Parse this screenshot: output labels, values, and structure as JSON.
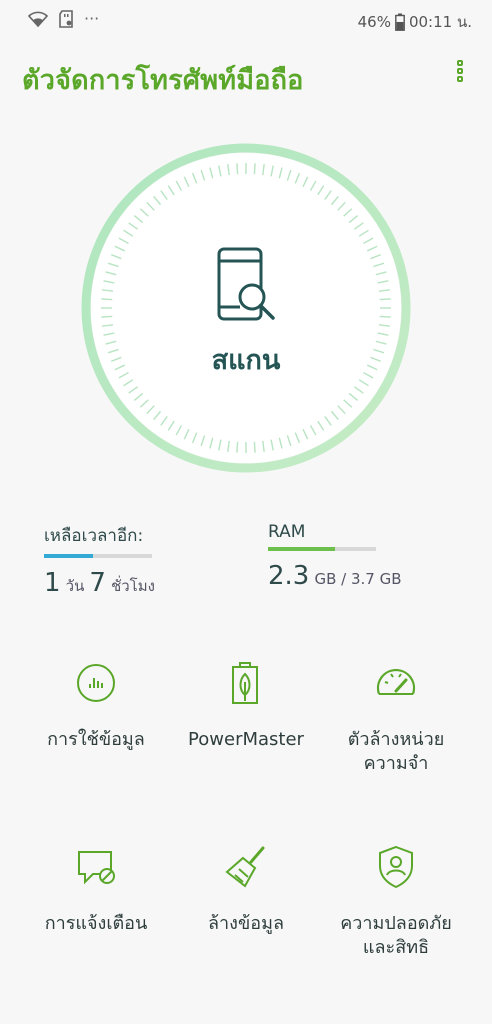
{
  "status_bar": {
    "icons": [
      "wifi-icon",
      "sd-card-icon",
      "more-notifications-icon"
    ],
    "more": "···",
    "battery_percent": "46%",
    "time": "00:11 น."
  },
  "app": {
    "title": "ตัวจัดการโทรศัพท์มือถือ",
    "accent_color": "#5aa72a"
  },
  "scan": {
    "label": "สแกน",
    "icon": "phone-search-icon"
  },
  "battery_stat": {
    "label": "เหลือเวลาอีก:",
    "days": "1",
    "days_unit": "วัน",
    "hours": "7",
    "hours_unit": "ชั่วโมง",
    "bar_fraction": 0.45,
    "bar_color": "#33a9d6"
  },
  "ram_stat": {
    "label": "RAM",
    "used": "2.3",
    "rest": "GB / 3.7 GB",
    "bar_fraction": 0.62,
    "bar_color": "#6dc04b"
  },
  "tiles": [
    {
      "label": "การใช้ข้อมูล",
      "icon": "data-usage-icon"
    },
    {
      "label": "PowerMaster",
      "icon": "battery-leaf-icon"
    },
    {
      "label": "ตัวล้างหน่วยความจำ",
      "line1": "ตัวล้างหน่วย",
      "line2": "ความจำ",
      "icon": "speedometer-icon"
    },
    {
      "label": "การแจ้งเตือน",
      "icon": "notification-block-icon"
    },
    {
      "label": "ล้างข้อมูล",
      "icon": "broom-icon"
    },
    {
      "label": "ความปลอดภัยและสิทธิ",
      "line1": "ความปลอดภัย",
      "line2": "และสิทธิ",
      "icon": "security-shield-icon"
    }
  ]
}
